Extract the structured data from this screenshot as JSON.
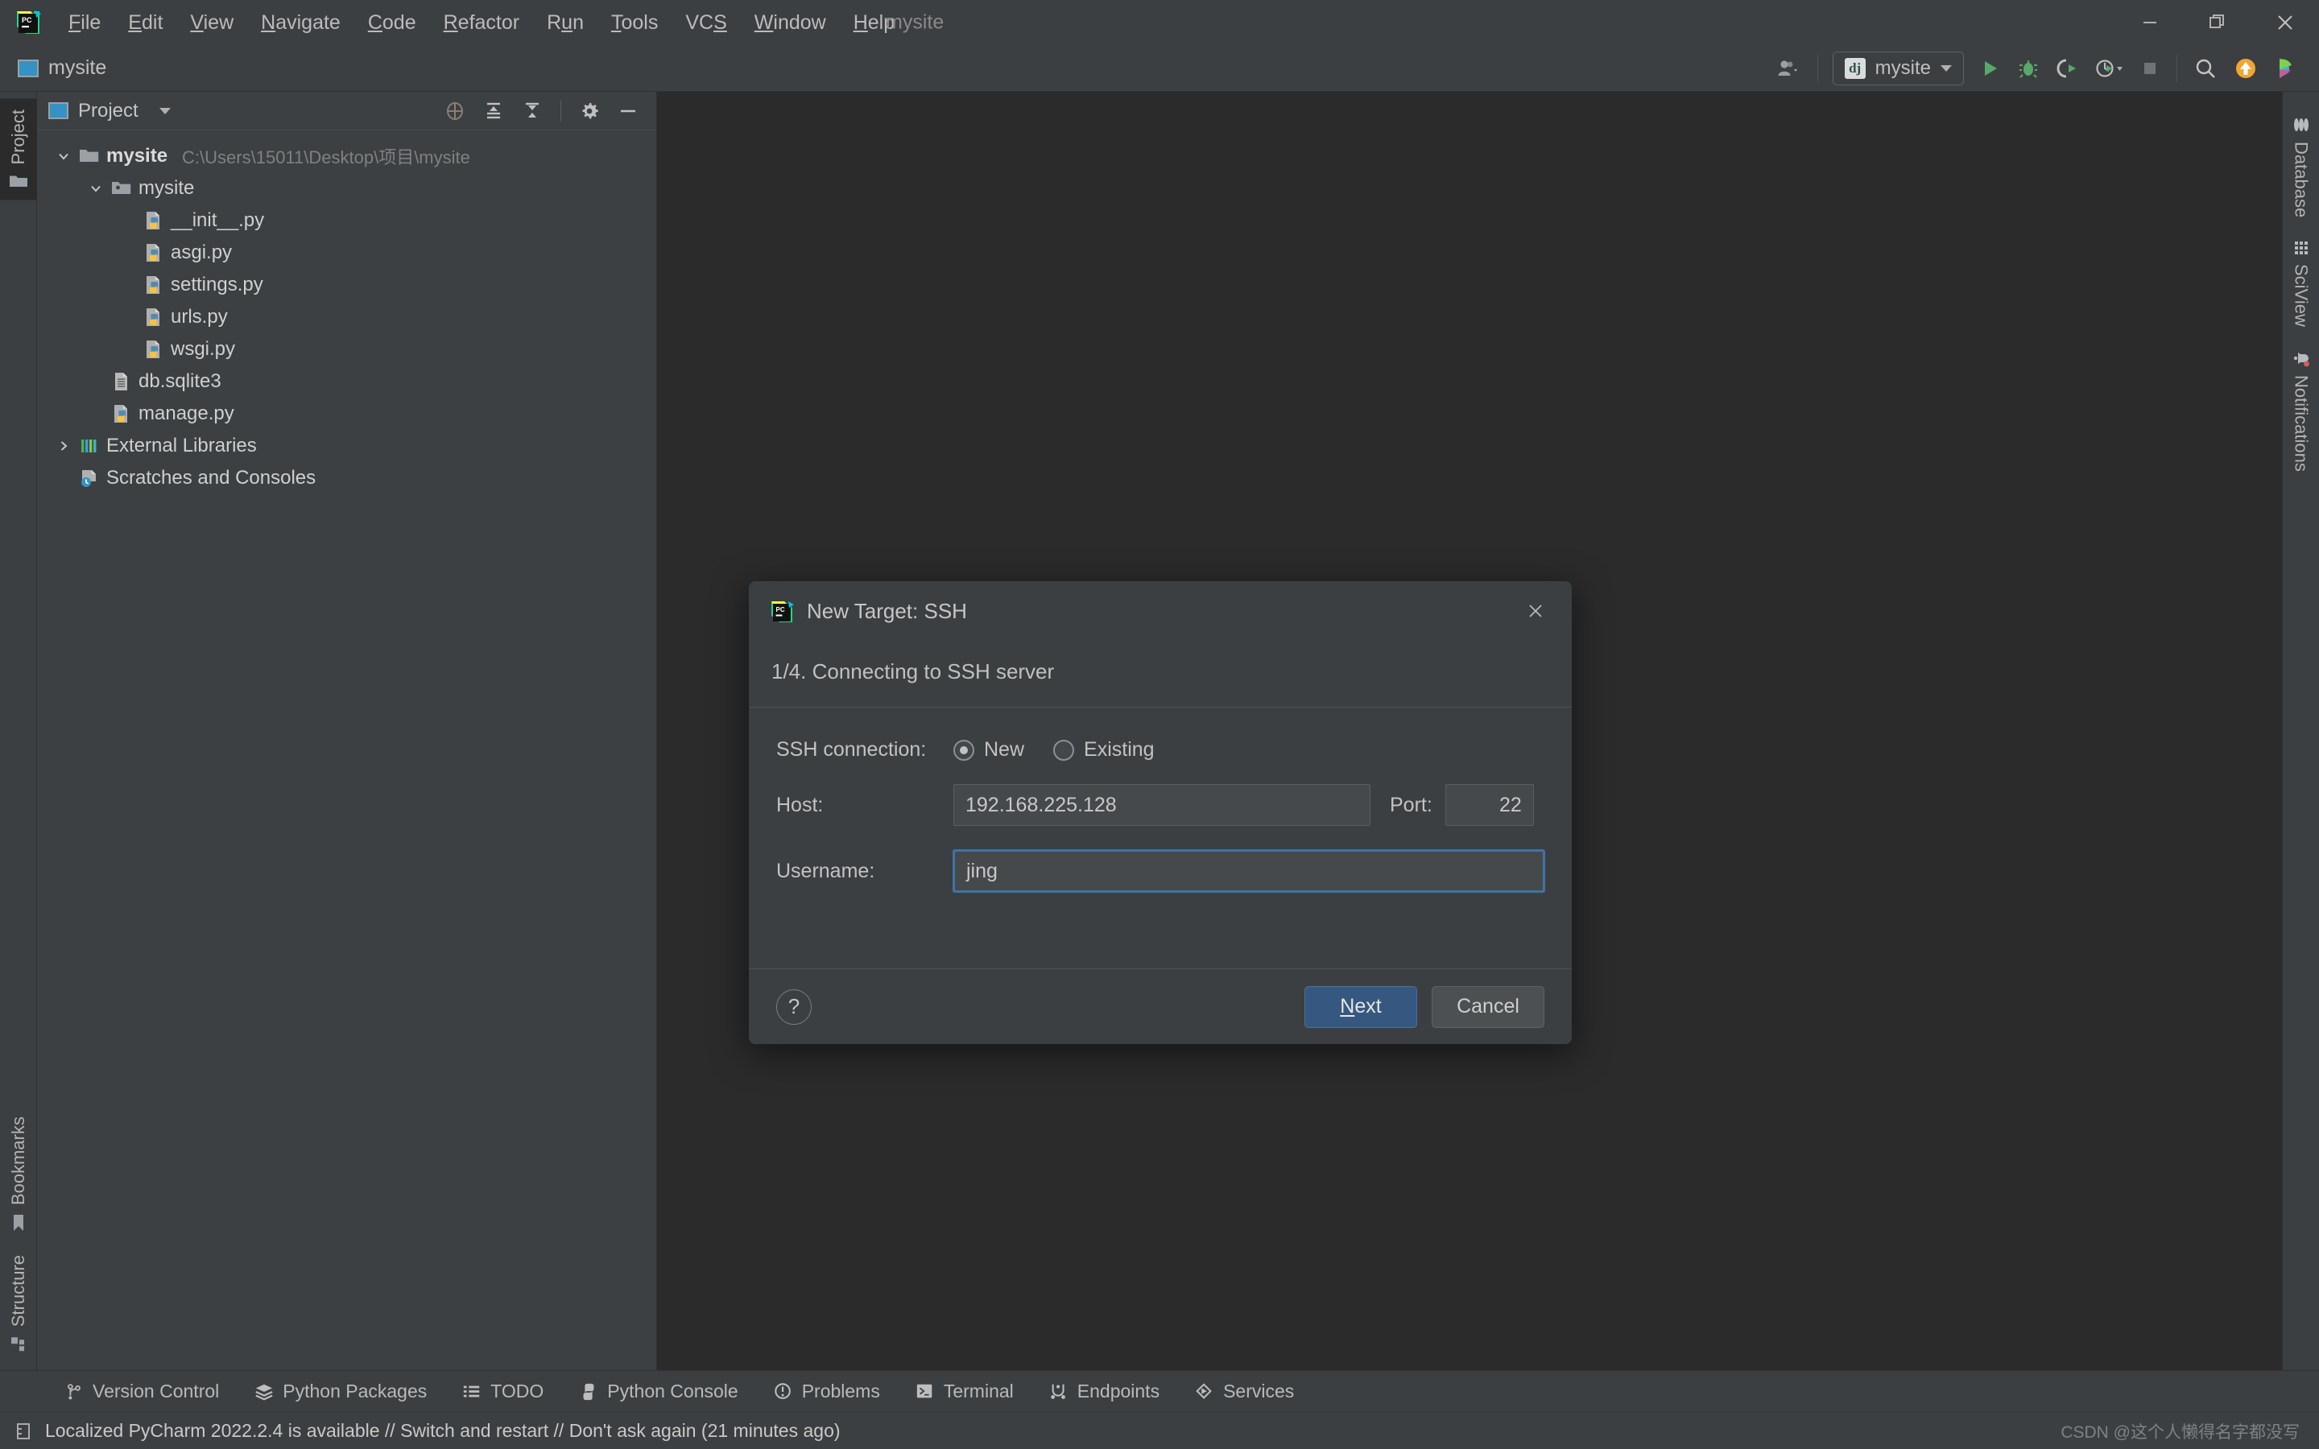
{
  "window": {
    "title": "mysite",
    "controls": {
      "minimize": "minimize-icon",
      "restore": "restore-icon",
      "close": "close-icon"
    }
  },
  "menubar": {
    "items": [
      {
        "label": "File",
        "mnemonic": "F"
      },
      {
        "label": "Edit",
        "mnemonic": "E"
      },
      {
        "label": "View",
        "mnemonic": "V"
      },
      {
        "label": "Navigate",
        "mnemonic": "N"
      },
      {
        "label": "Code",
        "mnemonic": "C"
      },
      {
        "label": "Refactor",
        "mnemonic": "R"
      },
      {
        "label": "Run",
        "mnemonic": "u"
      },
      {
        "label": "Tools",
        "mnemonic": "T"
      },
      {
        "label": "VCS",
        "mnemonic": "S"
      },
      {
        "label": "Window",
        "mnemonic": "W"
      },
      {
        "label": "Help",
        "mnemonic": "H"
      }
    ]
  },
  "toolbar": {
    "breadcrumb": "mysite",
    "account_icon": "account-icon",
    "run_config": {
      "icon_text": "dj",
      "label": "mysite"
    },
    "run_label": "Run",
    "debug_label": "Debug",
    "coverage_label": "Run with Coverage",
    "profile_label": "Profile",
    "stop_label": "Stop",
    "search_label": "Search Everywhere",
    "update_label": "Update Project",
    "ide_label": "IDE and Project Settings"
  },
  "left_strip": {
    "top": [
      {
        "label": "Project",
        "icon": "folder-icon",
        "active": true
      }
    ],
    "bottom": [
      {
        "label": "Bookmarks",
        "icon": "bookmark-icon"
      },
      {
        "label": "Structure",
        "icon": "structure-icon"
      }
    ]
  },
  "right_strip": {
    "items": [
      {
        "label": "Database",
        "icon": "database-icon"
      },
      {
        "label": "SciView",
        "icon": "grid-icon"
      },
      {
        "label": "Notifications",
        "icon": "bell-icon",
        "badge": true
      }
    ]
  },
  "project_panel": {
    "title": "Project",
    "dropdown_icon": "chevron-down-icon",
    "actions": [
      {
        "name": "select-opened-file-icon",
        "label": "Select Opened File"
      },
      {
        "name": "expand-all-icon",
        "label": "Expand All"
      },
      {
        "name": "collapse-all-icon",
        "label": "Collapse All"
      },
      {
        "name": "gear-icon",
        "label": "Options"
      },
      {
        "name": "hide-icon",
        "label": "Hide"
      }
    ],
    "tree": [
      {
        "depth": 0,
        "arrow": "down",
        "icon": "folder-icon",
        "label": "mysite",
        "bold": true,
        "path": "C:\\Users\\15011\\Desktop\\项目\\mysite"
      },
      {
        "depth": 1,
        "arrow": "down",
        "icon": "module-folder-icon",
        "label": "mysite",
        "bold": false,
        "path": ""
      },
      {
        "depth": 2,
        "arrow": "none",
        "icon": "python-file-icon",
        "label": "__init__.py",
        "bold": false,
        "path": ""
      },
      {
        "depth": 2,
        "arrow": "none",
        "icon": "python-file-icon",
        "label": "asgi.py",
        "bold": false,
        "path": ""
      },
      {
        "depth": 2,
        "arrow": "none",
        "icon": "python-file-icon",
        "label": "settings.py",
        "bold": false,
        "path": ""
      },
      {
        "depth": 2,
        "arrow": "none",
        "icon": "python-file-icon",
        "label": "urls.py",
        "bold": false,
        "path": ""
      },
      {
        "depth": 2,
        "arrow": "none",
        "icon": "python-file-icon",
        "label": "wsgi.py",
        "bold": false,
        "path": ""
      },
      {
        "depth": 1,
        "arrow": "none",
        "icon": "db-file-icon",
        "label": "db.sqlite3",
        "bold": false,
        "path": ""
      },
      {
        "depth": 1,
        "arrow": "none",
        "icon": "python-file-icon",
        "label": "manage.py",
        "bold": false,
        "path": ""
      },
      {
        "depth": 0,
        "arrow": "right",
        "icon": "library-icon",
        "label": "External Libraries",
        "bold": false,
        "path": ""
      },
      {
        "depth": 0,
        "arrow": "none",
        "icon": "scratches-icon",
        "label": "Scratches and Consoles",
        "bold": false,
        "path": ""
      }
    ]
  },
  "dialog": {
    "app_icon": "pycharm-icon",
    "title": "New Target: SSH",
    "close_icon": "close-icon",
    "step": "1/4. Connecting to SSH server",
    "connection": {
      "label": "SSH connection:",
      "options": [
        {
          "label": "New",
          "selected": true
        },
        {
          "label": "Existing",
          "selected": false
        }
      ]
    },
    "host": {
      "label": "Host:",
      "value": "192.168.225.128",
      "placeholder": ""
    },
    "port": {
      "label": "Port:",
      "value": "22",
      "placeholder": ""
    },
    "username": {
      "label": "Username:",
      "value": "jing",
      "placeholder": ""
    },
    "help_label": "?",
    "next_label": "Next",
    "next_mnemonic": "N",
    "cancel_label": "Cancel"
  },
  "bottom_bar": {
    "tabs": [
      {
        "label": "Version Control",
        "icon": "branch-icon"
      },
      {
        "label": "Python Packages",
        "icon": "packages-icon"
      },
      {
        "label": "TODO",
        "icon": "list-icon"
      },
      {
        "label": "Python Console",
        "icon": "python-icon"
      },
      {
        "label": "Problems",
        "icon": "problems-icon"
      },
      {
        "label": "Terminal",
        "icon": "terminal-icon"
      },
      {
        "label": "Endpoints",
        "icon": "endpoints-icon"
      },
      {
        "label": "Services",
        "icon": "services-icon"
      }
    ]
  },
  "status_bar": {
    "icon": "notification-icon",
    "message": "Localized PyCharm 2022.2.4 is available // Switch and restart // Don't ask again (21 minutes ago)",
    "watermark": "CSDN @这个人懒得名字都没写"
  },
  "colors": {
    "titlebar_bg": "#3C3F41",
    "sidebar_bg": "#3C4043",
    "editor_bg": "#2B2B2B",
    "accent_blue": "#3592C4",
    "primary_button": "#365880",
    "focus_border": "#3E73A8",
    "python_yellow": "#F5C242",
    "python_blue": "#4B8BBE"
  }
}
